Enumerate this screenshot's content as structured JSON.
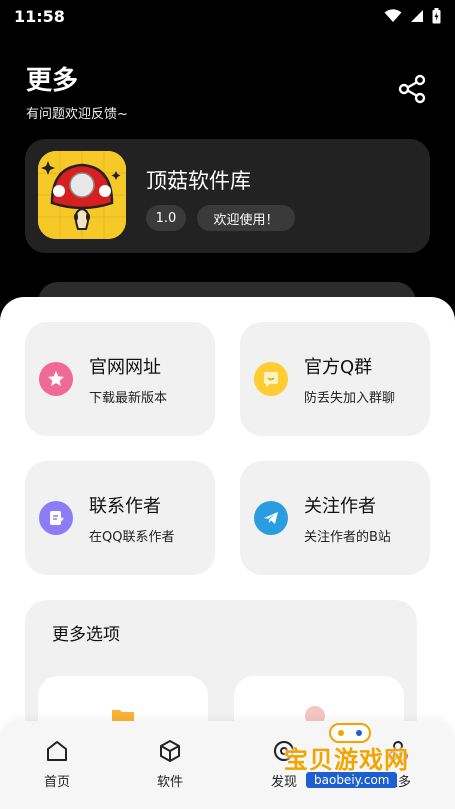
{
  "status_bar": {
    "time": "11:58"
  },
  "header": {
    "title": "更多",
    "subtitle": "有问题欢迎反馈~"
  },
  "app": {
    "name": "顶菇软件库",
    "version": "1.0",
    "welcome": "欢迎使用！"
  },
  "tiles": [
    {
      "title": "官网网址",
      "subtitle": "下载最新版本",
      "icon": "star-icon",
      "color": "#f06a98"
    },
    {
      "title": "官方Q群",
      "subtitle": "防丢失加入群聊",
      "icon": "smile-icon",
      "color": "#ffcc33"
    },
    {
      "title": "联系作者",
      "subtitle": "在QQ联系作者",
      "icon": "note-icon",
      "color": "#8d7cf5"
    },
    {
      "title": "关注作者",
      "subtitle": "关注作者的B站",
      "icon": "telegram-icon",
      "color": "#2a9de0"
    }
  ],
  "more": {
    "title": "更多选项"
  },
  "tabbar": {
    "items": [
      {
        "label": "首页",
        "icon": "home-icon"
      },
      {
        "label": "软件",
        "icon": "cube-icon"
      },
      {
        "label": "发现",
        "icon": "discover-icon"
      },
      {
        "label": "更多",
        "icon": "more-icon"
      }
    ]
  },
  "watermark": {
    "text": "宝贝游戏网",
    "url": "baobeiy.com"
  }
}
